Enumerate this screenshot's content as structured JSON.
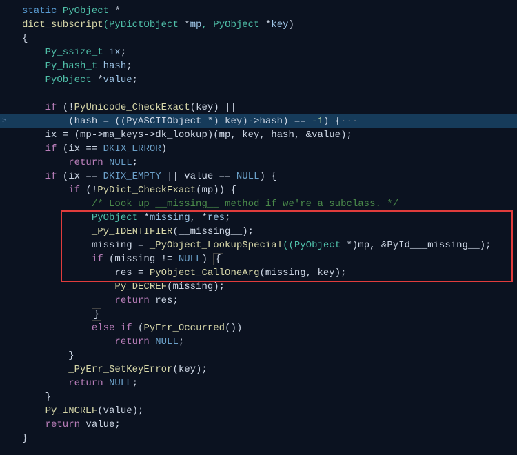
{
  "code": {
    "line1": {
      "a": "static",
      "b": " PyObject ",
      "c": "*"
    },
    "line2": {
      "a": "dict_subscript",
      "b": "(PyDictObject ",
      "c": "*",
      "d": "mp",
      "e": ", PyObject ",
      "f": "*",
      "g": "key",
      "h": ")"
    },
    "line3": {
      "a": "{"
    },
    "line4": {
      "a": "    Py_ssize_t ",
      "b": "ix",
      "c": ";"
    },
    "line5": {
      "a": "    Py_hash_t ",
      "b": "hash",
      "c": ";"
    },
    "line6": {
      "a": "    PyObject ",
      "b": "*",
      "c": "value",
      "d": ";"
    },
    "line7": {
      "a": ""
    },
    "line8": {
      "a": "    if",
      "b": " (!",
      "c": "PyUnicode_CheckExact",
      "d": "(key) ||"
    },
    "line9": {
      "a": "        (hash = ((PyASCIIObject ",
      "b": "*",
      "c": ") key)->hash) == ",
      "d": "-1",
      "e": ") {",
      "fold": "···"
    },
    "line10": {
      "a": "    ix = (mp->ma_keys->dk_lookup)(mp, key, hash, &value);"
    },
    "line11": {
      "a": "    if",
      "b": " (ix == ",
      "c": "DKIX_ERROR",
      "d": ")"
    },
    "line12": {
      "a": "        return",
      "b": " ",
      "c": "NULL",
      "d": ";"
    },
    "line13": {
      "a": "    if",
      "b": " (ix == ",
      "c": "DKIX_EMPTY",
      "d": " || value == ",
      "e": "NULL",
      "f": ") {"
    },
    "line14": {
      "a": "        if",
      "b": " (!",
      "c": "PyDict_CheckExact",
      "d": "(mp)) {"
    },
    "line15": {
      "a": "            /* Look up __missing__ method if we're a subclass. */"
    },
    "line16": {
      "a": "            PyObject ",
      "b": "*",
      "c": "missing",
      "d": ", ",
      "e": "*",
      "f": "res",
      "g": ";"
    },
    "line17": {
      "a": "            _Py_IDENTIFIER",
      "b": "(__missing__);"
    },
    "line18": {
      "a": "            missing = ",
      "b": "_PyObject_LookupSpecial",
      "c": "((PyObject ",
      "d": "*",
      "e": ")mp, &PyId___missing__);"
    },
    "line19": {
      "a": "            if",
      "b": " (missing != ",
      "c": "NULL",
      "d": ") ",
      "e": "{"
    },
    "line20": {
      "a": "                res = ",
      "b": "PyObject_CallOneArg",
      "c": "(missing, key);"
    },
    "line21": {
      "a": "                Py_DECREF",
      "b": "(missing);"
    },
    "line22": {
      "a": "                return",
      "b": " res;"
    },
    "line23": {
      "a": "            ",
      "b": "}"
    },
    "line24": {
      "a": "            else if",
      "b": " (",
      "c": "PyErr_Occurred",
      "d": "())"
    },
    "line25": {
      "a": "                return",
      "b": " ",
      "c": "NULL",
      "d": ";"
    },
    "line26": {
      "a": "        }"
    },
    "line27": {
      "a": "        _PyErr_SetKeyError",
      "b": "(key);"
    },
    "line28": {
      "a": "        return",
      "b": " ",
      "c": "NULL",
      "d": ";"
    },
    "line29": {
      "a": "    }"
    },
    "line30": {
      "a": "    Py_INCREF",
      "b": "(value);"
    },
    "line31": {
      "a": "    return",
      "b": " value;"
    },
    "line32": {
      "a": "}"
    }
  },
  "gutter_arrow": ">"
}
